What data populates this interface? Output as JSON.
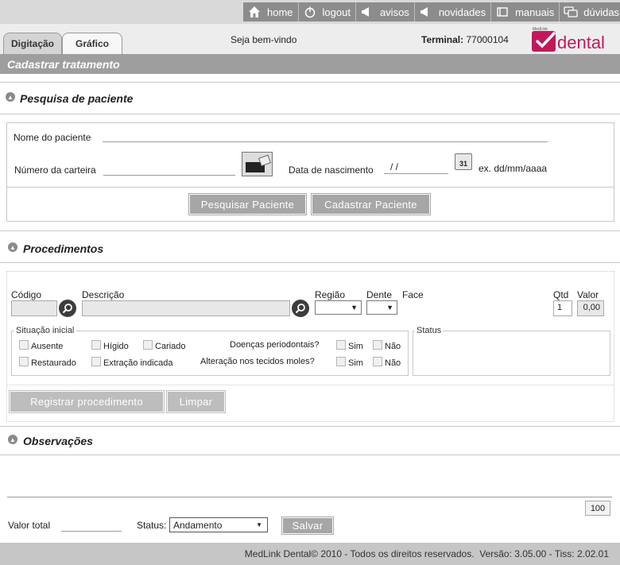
{
  "nav": {
    "items": [
      {
        "label": "home",
        "icon": "home-icon"
      },
      {
        "label": "logout",
        "icon": "power-icon"
      },
      {
        "label": "avisos",
        "icon": "megaphone-icon"
      },
      {
        "label": "novidades",
        "icon": "megaphone-icon"
      },
      {
        "label": "manuais",
        "icon": "book-icon"
      },
      {
        "label": "dúvidas",
        "icon": "chat-icon"
      }
    ]
  },
  "header": {
    "tabs": [
      "Digitação",
      "Gráfico"
    ],
    "welcome": "Seja bem-vindo",
    "terminal_label": "Terminal:",
    "terminal_value": "77000104",
    "logo_small": "MedLink",
    "logo_text": "dental"
  },
  "page_title": "Cadastrar tratamento",
  "patient_search": {
    "title": "Pesquisa de paciente",
    "name_label": "Nome do paciente",
    "card_label": "Número da carteira",
    "birth_label": "Data de nascimento",
    "birth_value": "/ /",
    "calendar_day": "31",
    "date_hint": "ex. dd/mm/aaaa",
    "search_button": "Pesquisar Paciente",
    "register_button": "Cadastrar Paciente"
  },
  "procedures": {
    "title": "Procedimentos",
    "code_label": "Código",
    "desc_label": "Descrição",
    "region_label": "Região",
    "tooth_label": "Dente",
    "face_label": "Face",
    "qty_label": "Qtd",
    "qty_value": "1",
    "value_label": "Valor",
    "value_value": "0,00",
    "initial_legend": "Situação inicial",
    "status_legend": "Status",
    "checks": {
      "absent": "Ausente",
      "healthy": "Hígido",
      "decayed": "Cariado",
      "restored": "Restaurado",
      "extraction": "Extração indicada"
    },
    "perio_label": "Doenças periodontais?",
    "soft_label": "Alteração nos tecidos moles?",
    "yes": "Sim",
    "no": "Não",
    "register_button": "Registrar procedimento",
    "clear_button": "Limpar"
  },
  "observations": {
    "title": "Observações",
    "counter": "100",
    "total_label": "Valor total",
    "status_label": "Status:",
    "status_value": "Andamento",
    "save_button": "Salvar"
  },
  "footer": {
    "text": "MedLink Dental© 2010 - Todos os direitos reservados.  Versão: 3.05.00 - Tiss: 2.02.01"
  },
  "colors": {
    "accent": "#c2185b",
    "bar": "#9e9e9e",
    "button": "#a6a6a6"
  }
}
